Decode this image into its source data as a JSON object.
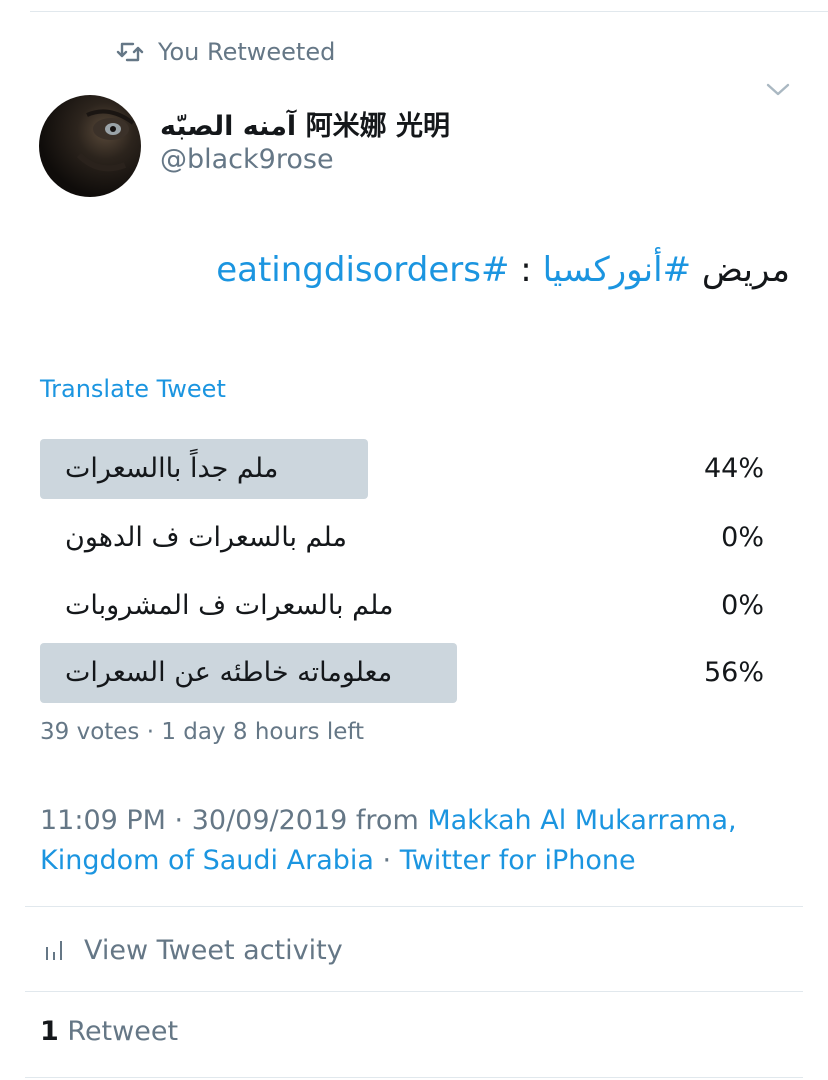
{
  "retweet_context": {
    "label": "You Retweeted",
    "icon": "retweet-icon"
  },
  "author": {
    "display_name": "آمنه الصبّه 阿米娜 光明",
    "handle": "@black9rose"
  },
  "tweet": {
    "word": "مريض",
    "hashtag_1": "#أنوركسيا",
    "separator": " : ",
    "hashtag_2": "#eatingdisorders"
  },
  "translate_label": "Translate Tweet",
  "poll": {
    "options": [
      {
        "label": "ملم جداً باالسعرات",
        "percent_text": "44%",
        "percent": 44
      },
      {
        "label": "ملم بالسعرات ف الدهون",
        "percent_text": "0%",
        "percent": 0
      },
      {
        "label": "ملم بالسعرات ف المشروبات",
        "percent_text": "0%",
        "percent": 0
      },
      {
        "label": "معلوماته خاطئه عن السعرات",
        "percent_text": "56%",
        "percent": 56
      }
    ],
    "meta": "39 votes · 1 day 8 hours left"
  },
  "timestamp": {
    "time_date": "11:09 PM · 30/09/2019 from ",
    "location": "Makkah Al Mukarrama, Kingdom of Saudi Arabia",
    "dot": " · ",
    "client": "Twitter for iPhone"
  },
  "activity_label": "View Tweet activity",
  "retweets": {
    "count": "1",
    "label": "Retweet"
  },
  "colors": {
    "link": "#1b95e0",
    "secondary_text": "#657786",
    "poll_bar": "#ccd6dd",
    "divider": "#e1e8ed"
  }
}
